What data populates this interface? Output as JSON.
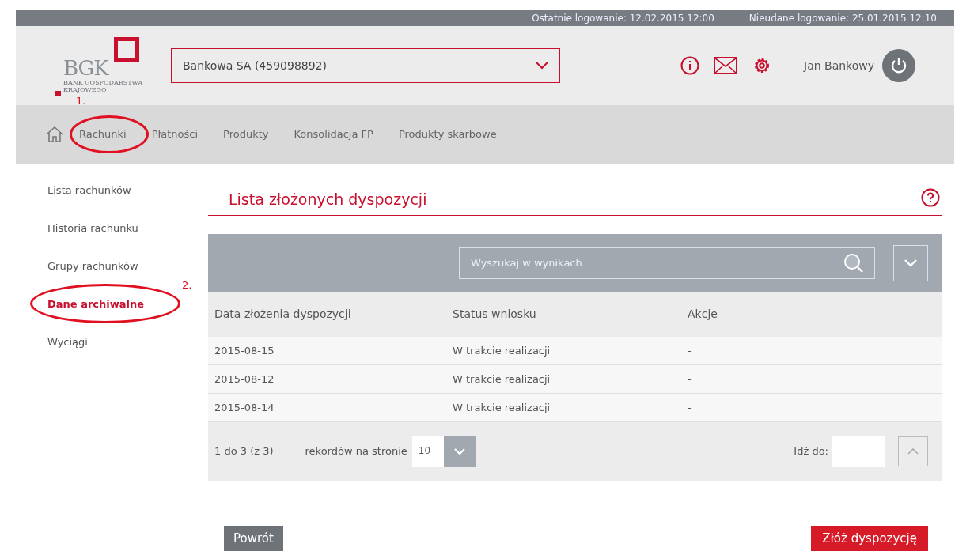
{
  "top_bar": {
    "last_login": "Ostatnie logowanie: 12.02.2015 12:00",
    "failed_login": "Nieudane logowanie: 25.01.2015 12:10"
  },
  "logo": {
    "letters": "BGK",
    "line_1": "BANK GOSPODARSTWA",
    "line_2": "KRAJOWEGO"
  },
  "company_select": {
    "value": "Bankowa SA (459098892)"
  },
  "user": {
    "name": "Jan Bankowy"
  },
  "nav": [
    {
      "label": "Rachunki",
      "selected": true,
      "annotation": "1."
    },
    {
      "label": "Płatności",
      "selected": false
    },
    {
      "label": "Produkty",
      "selected": false
    },
    {
      "label": "Konsolidacja FP",
      "selected": false
    },
    {
      "label": "Produkty skarbowe",
      "selected": false
    }
  ],
  "sidebar": {
    "items": [
      {
        "label": "Lista rachunków",
        "selected": false
      },
      {
        "label": "Historia rachunku",
        "selected": false
      },
      {
        "label": "Grupy rachunków",
        "selected": false
      },
      {
        "label": "Dane archiwalne",
        "selected": true,
        "annotation": "2."
      },
      {
        "label": "Wyciągi",
        "selected": false
      }
    ]
  },
  "title": "Lista złożonych dyspozycji",
  "search": {
    "placeholder": "Wyszukaj w wynikach"
  },
  "table": {
    "columns": [
      "Data złożenia dyspozycji",
      "Status wniosku",
      "Akcje"
    ],
    "rows": [
      [
        "2015-08-15",
        "W trakcie realizacji",
        "-"
      ],
      [
        "2015-08-12",
        "W trakcie realizacji",
        "-"
      ],
      [
        "2015-08-14",
        "W trakcie realizacji",
        "-"
      ]
    ]
  },
  "pagination": {
    "range": "1 do 3 (z 3)",
    "per_page_label": "rekordów na stronie",
    "per_page": "10",
    "goto_label": "Idź do:"
  },
  "buttons": {
    "back": "Powrót",
    "submit": "Złóż dyspozycję"
  }
}
